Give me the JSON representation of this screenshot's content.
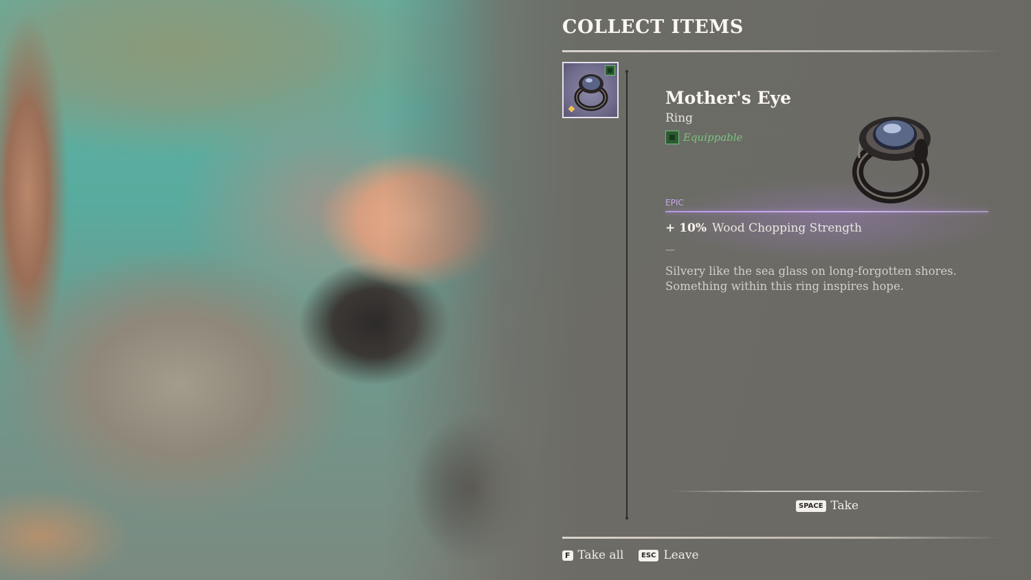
{
  "panel": {
    "title": "COLLECT ITEMS"
  },
  "slot": {
    "icon": "ring-icon",
    "badge_icon": "equippable-icon",
    "marker_icon": "new-item-diamond-icon",
    "frame_color": "#e7e1ef"
  },
  "item": {
    "name": "Mother's Eye",
    "type": "Ring",
    "equippable_label": "Equippable",
    "rarity": "EPIC",
    "rarity_color": "#c7a8ee",
    "stat_value": "+ 10%",
    "stat_label": "Wood Chopping Strength",
    "separator": "—",
    "description": "Silvery like the sea glass on long-forgotten shores. Something within this ring inspires hope."
  },
  "prompts": {
    "take": {
      "key": "SPACE",
      "label": "Take"
    },
    "take_all": {
      "key": "F",
      "label": "Take all"
    },
    "leave": {
      "key": "ESC",
      "label": "Leave"
    }
  }
}
